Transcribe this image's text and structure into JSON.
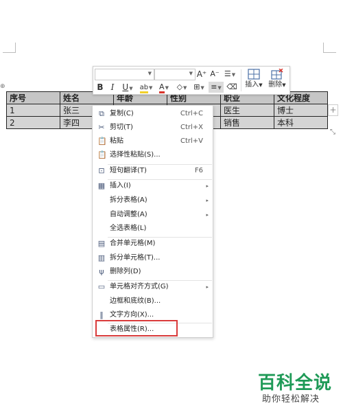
{
  "table": {
    "headers": [
      "序号",
      "姓名",
      "年龄",
      "性别",
      "职业",
      "文化程度"
    ],
    "rows": [
      [
        "1",
        "张三",
        "",
        "",
        "医生",
        "博士"
      ],
      [
        "2",
        "李四",
        "",
        "",
        "销售",
        "本科"
      ]
    ]
  },
  "handles": {
    "move": "⊕",
    "add": "+",
    "resize": "⤡"
  },
  "toolbar": {
    "grow_font": "A⁺",
    "shrink_font": "A⁻",
    "line_spacing": "☰",
    "bold": "B",
    "italic": "I",
    "underline": "U",
    "highlight": "ab",
    "font_color": "A",
    "fill": "◇",
    "borders": "⊞",
    "align": "≡",
    "eraser": "⌫",
    "insert_label": "插入",
    "delete_label": "删除",
    "dropdown_arrow": "▼"
  },
  "menu": {
    "items": [
      {
        "icon": "⧉",
        "label": "复制(C)",
        "shortcut": "Ctrl+C"
      },
      {
        "icon": "✂",
        "label": "剪切(T)",
        "shortcut": "Ctrl+X"
      },
      {
        "icon": "📋",
        "label": "粘贴",
        "shortcut": "Ctrl+V"
      },
      {
        "icon": "📋",
        "label": "选择性粘贴(S)..."
      },
      {
        "icon": "⊡",
        "label": "短句翻译(T)",
        "shortcut": "F6"
      },
      {
        "icon": "▦",
        "label": "插入(I)",
        "arrow": "▸"
      },
      {
        "label": "拆分表格(A)",
        "arrow": "▸"
      },
      {
        "label": "自动调整(A)",
        "arrow": "▸"
      },
      {
        "label": "全选表格(L)"
      },
      {
        "icon": "▤",
        "label": "合并单元格(M)"
      },
      {
        "icon": "▥",
        "label": "拆分单元格(T)..."
      },
      {
        "icon": "ψ",
        "label": "删除列(D)"
      },
      {
        "icon": "▭",
        "label": "单元格对齐方式(G)",
        "arrow": "▸"
      },
      {
        "label": "边框和底纹(B)..."
      },
      {
        "icon": "‖",
        "label": "文字方向(X)..."
      },
      {
        "label": "表格属性(R)..."
      }
    ]
  },
  "watermark": {
    "title": "百科全说",
    "subtitle": "助你轻松解决"
  },
  "colors": {
    "highlight_border": "#d93a3a",
    "watermark_green": "#1f9a57"
  }
}
